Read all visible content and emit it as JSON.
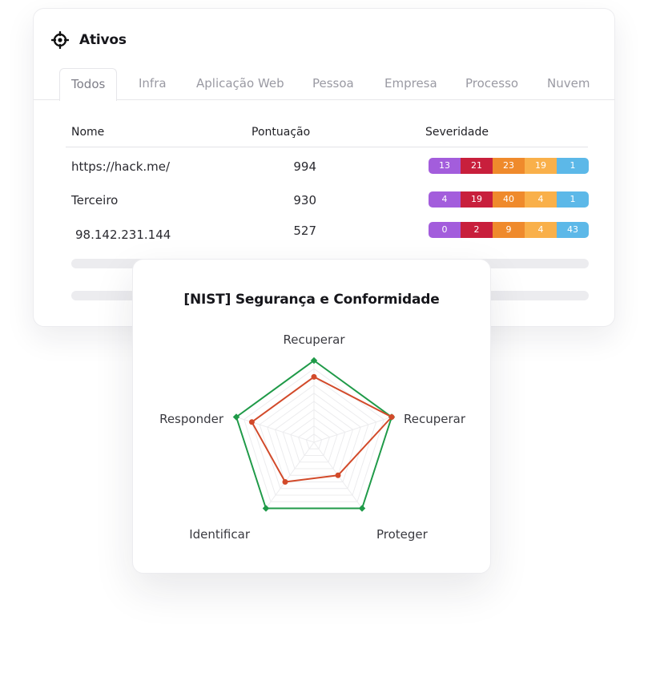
{
  "assets": {
    "title": "Ativos",
    "tabs": [
      "Todos",
      "Infra",
      "Aplicação Web",
      "Pessoa",
      "Empresa",
      "Processo",
      "Nuvem"
    ],
    "active_tab": "Todos",
    "columns": {
      "name": "Nome",
      "score": "Pontuação",
      "severity": "Severidade"
    },
    "rows": [
      {
        "name": "https://hack.me/",
        "score": "994",
        "severity": [
          "13",
          "21",
          "23",
          "19",
          "1"
        ]
      },
      {
        "name": "Terceiro",
        "score": "930",
        "severity": [
          "4",
          "19",
          "40",
          "4",
          "1"
        ]
      },
      {
        "name": "98.142.231.144",
        "score": "527",
        "severity": [
          "0",
          "2",
          "9",
          "4",
          "43"
        ]
      }
    ],
    "severity_colors": [
      "#a35ddc",
      "#c81f3c",
      "#ef8a2c",
      "#f9b04a",
      "#5cb8e8"
    ]
  },
  "radar": {
    "title": "[NIST] Segurança e Conformidade",
    "axes": [
      "Recuperar",
      "Recuperar",
      "Proteger",
      "Identificar",
      "Responder"
    ],
    "max": 10,
    "series": [
      {
        "values": [
          10,
          10,
          10,
          10,
          10
        ],
        "color": "#1f9a48"
      },
      {
        "values": [
          8,
          10,
          5,
          6,
          8
        ],
        "color": "#d24a2a"
      }
    ]
  }
}
